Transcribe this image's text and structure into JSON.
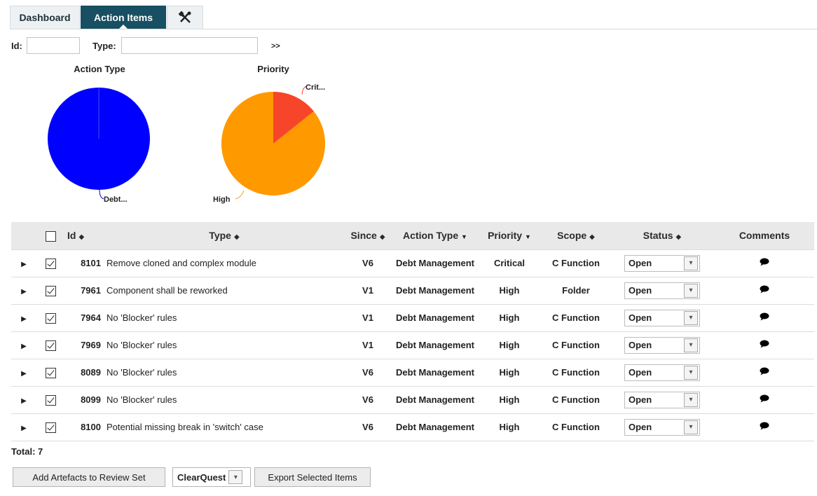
{
  "tabs": {
    "dashboard": "Dashboard",
    "action_items": "Action Items",
    "tools_icon": "✗"
  },
  "filter": {
    "id_label": "Id:",
    "id_value": "",
    "type_label": "Type:",
    "type_value": "",
    "go_label": ">>"
  },
  "charts": [
    {
      "title": "Action Type",
      "slices": [
        {
          "label": "Debt...",
          "value": 100,
          "color": "#0000ff"
        }
      ]
    },
    {
      "title": "Priority",
      "slices": [
        {
          "label": "Crit...",
          "value": 1,
          "color": "#f7452a"
        },
        {
          "label": "High",
          "value": 6,
          "color": "#ff9900"
        }
      ]
    }
  ],
  "table": {
    "headers": {
      "id": "Id",
      "type": "Type",
      "since": "Since",
      "action_type": "Action Type",
      "priority": "Priority",
      "scope": "Scope",
      "status": "Status",
      "comments": "Comments"
    },
    "sort_icon": "⬍",
    "dropdown_icon": "▾",
    "rows": [
      {
        "id": "8101",
        "type": "Remove cloned and complex module",
        "since": "V6",
        "action_type": "Debt Management",
        "priority": "Critical",
        "scope": "C Function",
        "status": "Open",
        "checked": true
      },
      {
        "id": "7961",
        "type": "Component shall be reworked",
        "since": "V1",
        "action_type": "Debt Management",
        "priority": "High",
        "scope": "Folder",
        "status": "Open",
        "checked": true
      },
      {
        "id": "7964",
        "type": "No 'Blocker' rules",
        "since": "V1",
        "action_type": "Debt Management",
        "priority": "High",
        "scope": "C Function",
        "status": "Open",
        "checked": true
      },
      {
        "id": "7969",
        "type": "No 'Blocker' rules",
        "since": "V1",
        "action_type": "Debt Management",
        "priority": "High",
        "scope": "C Function",
        "status": "Open",
        "checked": true
      },
      {
        "id": "8089",
        "type": "No 'Blocker' rules",
        "since": "V6",
        "action_type": "Debt Management",
        "priority": "High",
        "scope": "C Function",
        "status": "Open",
        "checked": true
      },
      {
        "id": "8099",
        "type": "No 'Blocker' rules",
        "since": "V6",
        "action_type": "Debt Management",
        "priority": "High",
        "scope": "C Function",
        "status": "Open",
        "checked": true
      },
      {
        "id": "8100",
        "type": "Potential missing break in 'switch' case",
        "since": "V6",
        "action_type": "Debt Management",
        "priority": "High",
        "scope": "C Function",
        "status": "Open",
        "checked": true
      }
    ]
  },
  "total": "Total: 7",
  "footer": {
    "add_button": "Add Artefacts to Review Set",
    "export_target": "ClearQuest",
    "export_button": "Export Selected Items"
  }
}
